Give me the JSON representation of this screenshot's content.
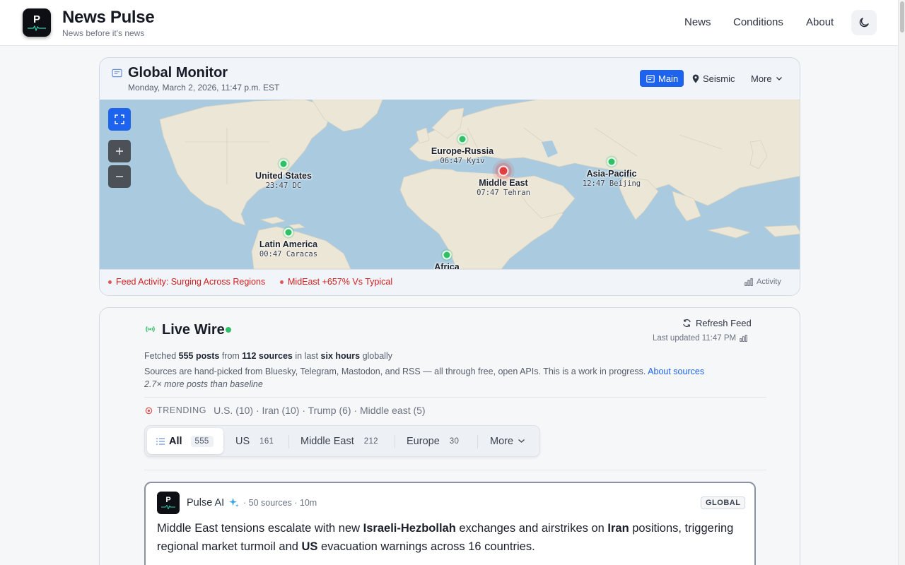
{
  "brand": {
    "title": "News Pulse",
    "subtitle": "News before it's news",
    "logo_letter": "P"
  },
  "nav": {
    "items": [
      "News",
      "Conditions",
      "About"
    ],
    "theme_icon": "moon-icon"
  },
  "monitor": {
    "title": "Global Monitor",
    "datetime": "Monday, March 2, 2026, 11:47 p.m. EST",
    "buttons": {
      "main": "Main",
      "seismic": "Seismic",
      "more": "More"
    },
    "regions": [
      {
        "name": "United States",
        "time": "23:47 DC",
        "status": "normal"
      },
      {
        "name": "Europe-Russia",
        "time": "06:47 Kyiv",
        "status": "normal"
      },
      {
        "name": "Middle East",
        "time": "07:47 Tehran",
        "status": "surging"
      },
      {
        "name": "Asia-Pacific",
        "time": "12:47 Beijing",
        "status": "normal"
      },
      {
        "name": "Latin America",
        "time": "00:47 Caracas",
        "status": "normal"
      },
      {
        "name": "Africa",
        "time": "",
        "status": "normal"
      }
    ],
    "alerts": [
      "Feed Activity: Surging Across Regions",
      "MidEast +657% Vs Typical"
    ],
    "activity_label": "Activity",
    "colors": {
      "accent": "#1d63ed",
      "normal": "#2fbf64",
      "surging": "#e24040",
      "alert_text": "#cf1f1f"
    }
  },
  "livewire": {
    "title": "Live Wire",
    "refresh_label": "Refresh Feed",
    "last_updated": "Last updated 11:47 PM",
    "fetched": {
      "prefix": "Fetched",
      "posts": "555 posts",
      "from": "from",
      "sources": "112 sources",
      "in_last": "in last",
      "window": "six hours",
      "suffix": "globally"
    },
    "sources_note": "Sources are hand-picked from Bluesky, Telegram, Mastodon, and RSS — all through free, open APIs. This is a work in progress.",
    "sources_link": "About sources",
    "baseline_note": "2.7× more posts than baseline",
    "trending_label": "TRENDING",
    "trending_items": "U.S. (10) · Iran (10) · Trump (6) · Middle east (5)",
    "filters": [
      {
        "label": "All",
        "count": "555",
        "active": true
      },
      {
        "label": "US",
        "count": "161"
      },
      {
        "label": "Middle East",
        "count": "212"
      },
      {
        "label": "Europe",
        "count": "30"
      },
      {
        "label": "More"
      }
    ]
  },
  "post": {
    "author": "Pulse AI",
    "meta": "· 50 sources · 10m",
    "tag": "GLOBAL",
    "body": {
      "t1": "Middle East tensions escalate with new ",
      "b1": "Israeli-Hezbollah",
      "t2": " exchanges and airstrikes on ",
      "b2": "Iran",
      "t3": " positions, triggering regional market turmoil and ",
      "b3": "US",
      "t4": " evacuation warnings across 16 countries."
    }
  }
}
